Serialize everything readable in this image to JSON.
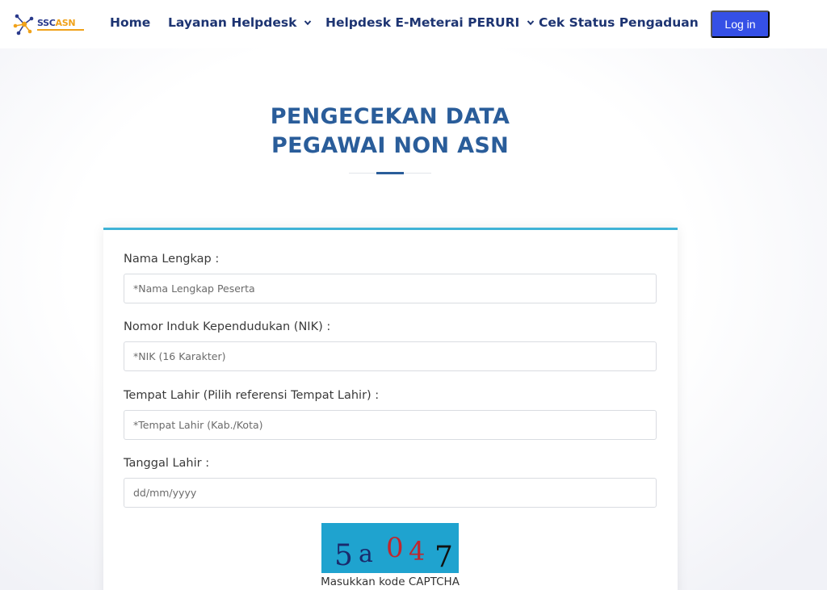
{
  "brand": {
    "logo_text_main": "SSC",
    "logo_text_accent": "ASN"
  },
  "nav": {
    "home": "Home",
    "layanan": "Layanan Helpdesk",
    "emeterai": "Helpdesk E-Meterai PERURI",
    "cek_status": "Cek Status Pengaduan",
    "login": "Log in"
  },
  "page": {
    "title_line1": "PENGECEKAN DATA",
    "title_line2": "PEGAWAI NON ASN"
  },
  "form": {
    "nama": {
      "label": "Nama Lengkap :",
      "placeholder": "*Nama Lengkap Peserta",
      "value": ""
    },
    "nik": {
      "label": "Nomor Induk Kependudukan (NIK) :",
      "placeholder": "*NIK (16 Karakter)",
      "value": ""
    },
    "tempat": {
      "label": "Tempat Lahir (Pilih referensi Tempat Lahir) :",
      "placeholder": "*Tempat Lahir (Kab./Kota)",
      "value": ""
    },
    "tanggal": {
      "label": "Tanggal Lahir :",
      "placeholder": "dd/mm/yyyy",
      "value": ""
    },
    "captcha": {
      "chars": [
        "5",
        "a",
        "0",
        "4",
        "7"
      ],
      "colors": [
        "#1a2a6c",
        "#1a2a6c",
        "#c0262d",
        "#c0262d",
        "#111111"
      ],
      "label": "Masukkan kode CAPTCHA"
    }
  },
  "colors": {
    "nav_text": "#1d3472",
    "login_bg": "#3550e6",
    "title": "#2a5d9a",
    "card_accent": "#3fb3d6",
    "captcha_bg": "#1fa3cf"
  }
}
